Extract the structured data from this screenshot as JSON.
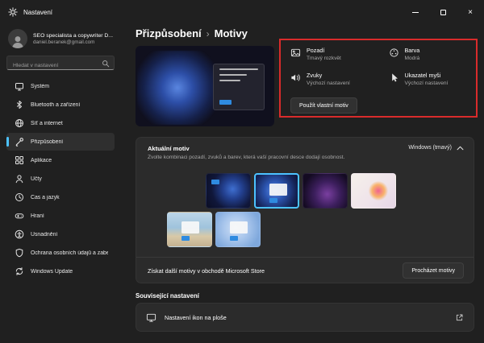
{
  "titlebar": {
    "title": "Nastavení"
  },
  "sidebar": {
    "user": {
      "name": "SEO specialista a copywriter D...",
      "email": "daniel.beranek@gmail.com"
    },
    "search": {
      "placeholder": "Hledat v nastavení"
    },
    "items": [
      {
        "label": "Systém"
      },
      {
        "label": "Bluetooth a zařízení"
      },
      {
        "label": "Síť a internet"
      },
      {
        "label": "Přizpůsobení",
        "selected": true
      },
      {
        "label": "Aplikace"
      },
      {
        "label": "Účty"
      },
      {
        "label": "Čas a jazyk"
      },
      {
        "label": "Hraní"
      },
      {
        "label": "Usnadnění"
      },
      {
        "label": "Ochrana osobních údajů a zabezpečení"
      },
      {
        "label": "Windows Update"
      }
    ]
  },
  "main": {
    "breadcrumb": {
      "parent": "Přizpůsobení",
      "separator": "›",
      "current": "Motivy"
    },
    "theme_settings": [
      {
        "label": "Pozadí",
        "value": "Tmavý rozkvět"
      },
      {
        "label": "Barva",
        "value": "Modrá"
      },
      {
        "label": "Zvuky",
        "value": "Výchozí nastavení"
      },
      {
        "label": "Ukazatel myši",
        "value": "Výchozí nastavení"
      }
    ],
    "save_theme_button": "Použít vlastní motiv",
    "current_theme": {
      "title": "Aktuální motiv",
      "subtitle": "Zvolte kombinaci pozadí, zvuků a barev, která vaší pracovní desce dodají osobnost.",
      "selected_value": "Windows (tmavý)",
      "expanded": true,
      "thumbnails": [
        {
          "name": "theme-dark-bloom",
          "selected": false
        },
        {
          "name": "theme-windows-dark",
          "selected": true
        },
        {
          "name": "theme-glow",
          "selected": false
        },
        {
          "name": "theme-captured-motion",
          "selected": false
        },
        {
          "name": "theme-sunrise",
          "selected": false
        },
        {
          "name": "theme-light-bloom",
          "selected": false
        }
      ]
    },
    "store_row": {
      "label": "Získat další motivy v obchodě Microsoft Store",
      "button": "Procházet motivy"
    },
    "related": {
      "title": "Související nastavení",
      "items": [
        {
          "label": "Nastavení ikon na ploše"
        }
      ]
    }
  },
  "colors": {
    "window_bg": "#202020",
    "card_bg": "#2b2b2b",
    "accent": "#4cc2ff",
    "thumbnail_accent": "#2f8be0",
    "annotation": "#d92b2b"
  }
}
